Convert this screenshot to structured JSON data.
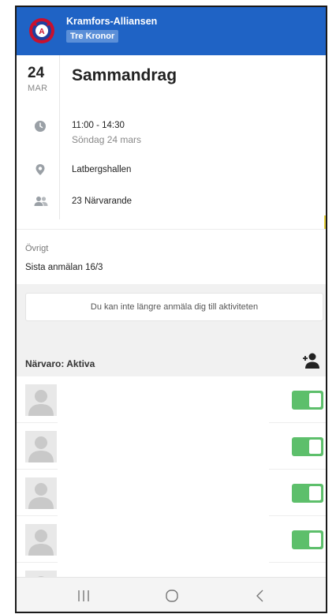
{
  "header": {
    "org_name": "Kramfors-Alliansen",
    "team_name": "Tre Kronor",
    "logo_letter": "A",
    "brand_color": "#1f63c5"
  },
  "summary": {
    "date_day": "24",
    "date_month": "MAR",
    "title": "Sammandrag",
    "time_range": "11:00 - 14:30",
    "date_long": "Söndag 24 mars",
    "location": "Latbergshallen",
    "attendance_count": "23 Närvarande",
    "icons": [
      "clock-icon",
      "location-pin-icon",
      "people-icon"
    ]
  },
  "other": {
    "label": "Övrigt",
    "value": "Sista anmälan 16/3"
  },
  "notice": {
    "text": "Du kan inte längre anmäla dig till aktiviteten"
  },
  "attendance": {
    "title": "Närvaro: Aktiva",
    "add_icon": "add-person-icon",
    "members": [
      {
        "present": true
      },
      {
        "present": true
      },
      {
        "present": true
      },
      {
        "present": true
      },
      {
        "present": true
      }
    ],
    "toggle_on_color": "#5dbf6b"
  },
  "navbar": {
    "buttons": [
      "recent-apps-icon",
      "home-icon",
      "back-icon"
    ]
  }
}
